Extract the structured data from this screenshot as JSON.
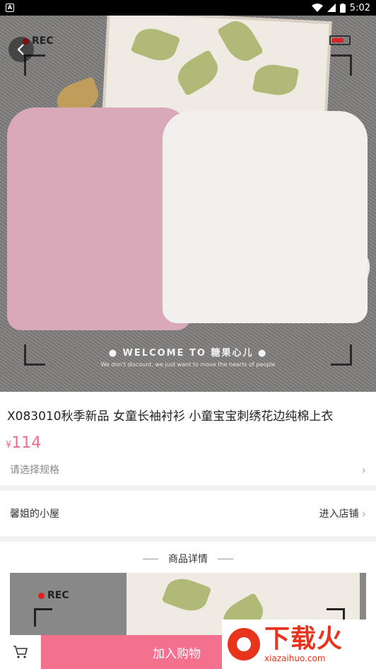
{
  "status_bar": {
    "app_icon": "A",
    "time": "5:02",
    "icons": [
      "wifi-icon",
      "signal-icon",
      "battery-icon"
    ]
  },
  "hero": {
    "rec": "REC",
    "welcome": "● WELCOME TO 糖果心儿 ●",
    "welcome_sub": "We don't discount, we just want to move the hearts of people"
  },
  "product": {
    "title": "X083010秋季新品 女童长袖衬衫 小童宝宝刺绣花边纯棉上衣",
    "currency": "¥",
    "price": "114",
    "spec_label": "请选择规格"
  },
  "shop": {
    "name": "馨姐的小屋",
    "enter_label": "进入店铺"
  },
  "detail": {
    "header": "商品详情",
    "rec": "REC"
  },
  "bottom_bar": {
    "add_to_cart": "加入购物"
  },
  "watermark": {
    "title": "下载火",
    "url": "xiazaihuo.com"
  },
  "colors": {
    "accent": "#f3708f",
    "price": "#f06a8a",
    "watermark": "#e8341c"
  }
}
